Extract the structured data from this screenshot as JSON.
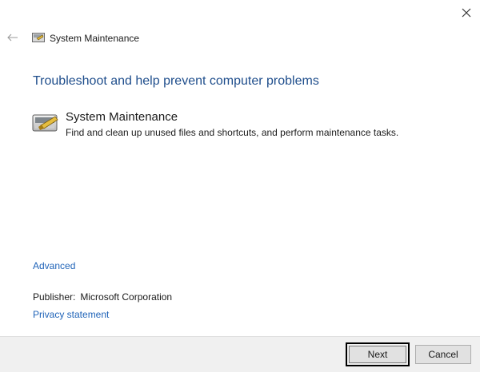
{
  "window": {
    "title": "System Maintenance",
    "close_icon": "close-icon",
    "back_icon": "back-arrow-icon"
  },
  "main": {
    "heading": "Troubleshoot and help prevent computer problems",
    "task": {
      "icon": "system-maintenance-icon",
      "title": "System Maintenance",
      "description": "Find and clean up unused files and shortcuts, and perform maintenance tasks."
    },
    "advanced_link": "Advanced",
    "publisher_label": "Publisher:",
    "publisher_value": "Microsoft Corporation",
    "privacy_link": "Privacy statement"
  },
  "footer": {
    "next_label": "Next",
    "cancel_label": "Cancel"
  },
  "colors": {
    "heading": "#1f4e8c",
    "link": "#1f63b8",
    "footer_bg": "#f0f0f0"
  }
}
